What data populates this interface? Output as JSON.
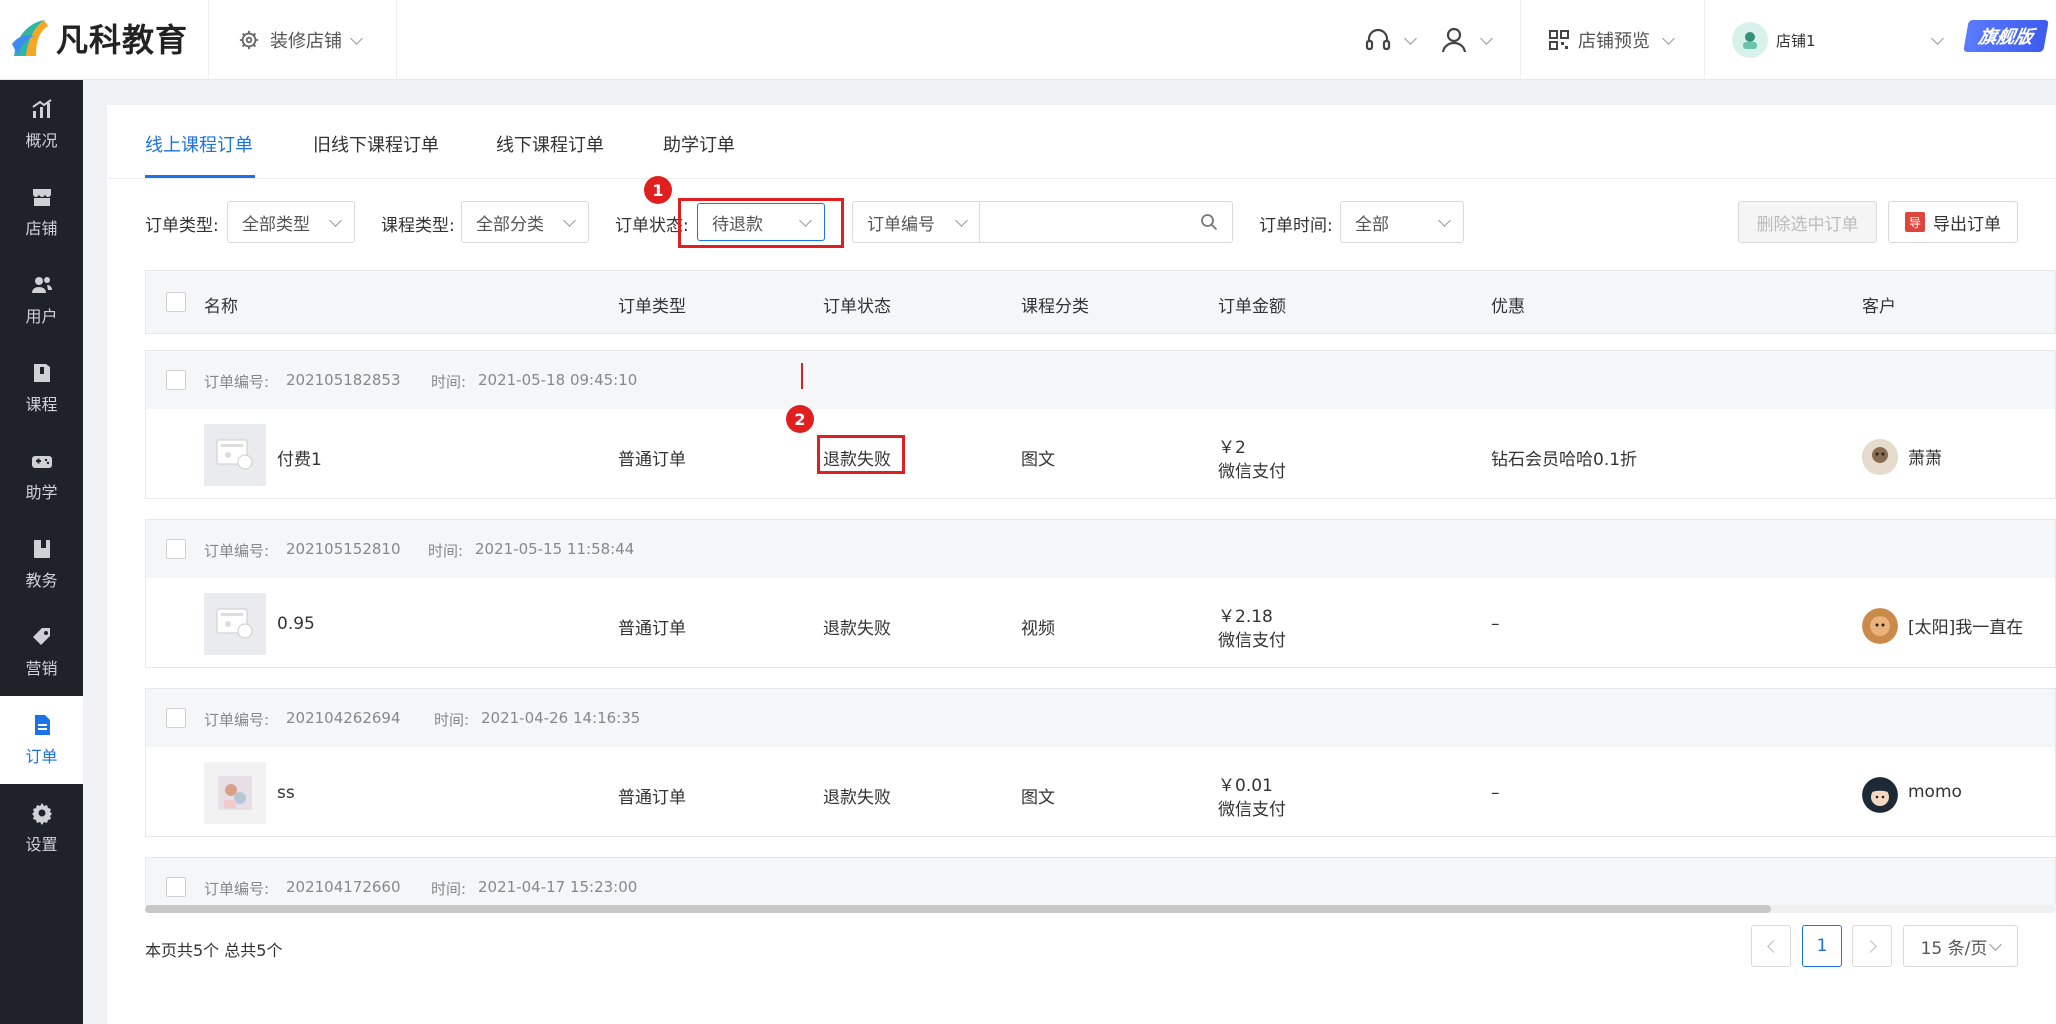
{
  "app": {
    "logo_text": "凡科教育"
  },
  "header": {
    "decorate_label": "装修店铺",
    "preview_label": "店铺预览",
    "store_name": "店铺1",
    "vip_badge": "旗舰版"
  },
  "sidebar": {
    "items": [
      {
        "label": "概况",
        "icon": "chart-icon"
      },
      {
        "label": "店铺",
        "icon": "store-icon"
      },
      {
        "label": "用户",
        "icon": "users-icon"
      },
      {
        "label": "课程",
        "icon": "book-icon"
      },
      {
        "label": "助学",
        "icon": "gamepad-icon"
      },
      {
        "label": "教务",
        "icon": "notebook-icon"
      },
      {
        "label": "营销",
        "icon": "tag-icon"
      },
      {
        "label": "订单",
        "icon": "document-icon"
      },
      {
        "label": "设置",
        "icon": "gear-icon"
      }
    ],
    "active": "订单"
  },
  "tabs": [
    {
      "label": "线上课程订单",
      "active": true
    },
    {
      "label": "旧线下课程订单",
      "active": false
    },
    {
      "label": "线下课程订单",
      "active": false
    },
    {
      "label": "助学订单",
      "active": false
    }
  ],
  "filters": {
    "order_type_label": "订单类型:",
    "order_type_value": "全部类型",
    "course_type_label": "课程类型:",
    "course_type_value": "全部分类",
    "status_label": "订单状态:",
    "status_value": "待退款",
    "search_field_select": "订单编号",
    "search_value": "",
    "time_label": "订单时间:",
    "time_value": "全部",
    "delete_button": "删除选中订单",
    "export_button": "导出订单",
    "export_icon_char": "导"
  },
  "annotations": {
    "step1": "1",
    "step2": "2"
  },
  "table": {
    "headers": [
      "名称",
      "订单类型",
      "订单状态",
      "课程分类",
      "订单金额",
      "优惠",
      "客户"
    ],
    "orders": [
      {
        "no_label": "订单编号:",
        "no": "202105182853",
        "time_label": "时间:",
        "time": "2021-05-18 09:45:10",
        "name": "付费1",
        "type": "普通订单",
        "status": "退款失败",
        "category": "图文",
        "amount": "￥2",
        "pay": "微信支付",
        "discount": "钻石会员哈哈0.1折",
        "customer": "萧萧"
      },
      {
        "no_label": "订单编号:",
        "no": "202105152810",
        "time_label": "时间:",
        "time": "2021-05-15 11:58:44",
        "name": "0.95",
        "type": "普通订单",
        "status": "退款失败",
        "category": "视频",
        "amount": "￥2.18",
        "pay": "微信支付",
        "discount": "–",
        "customer": "[太阳]我一直在"
      },
      {
        "no_label": "订单编号:",
        "no": "202104262694",
        "time_label": "时间:",
        "time": "2021-04-26 14:16:35",
        "name": "ss",
        "type": "普通订单",
        "status": "退款失败",
        "category": "图文",
        "amount": "￥0.01",
        "pay": "微信支付",
        "discount": "–",
        "customer": "momo"
      },
      {
        "no_label": "订单编号:",
        "no": "202104172660",
        "time_label": "时间:",
        "time": "2021-04-17 15:23:00"
      }
    ]
  },
  "footer": {
    "summary": "本页共5个 总共5个",
    "current_page": "1",
    "page_size": "15 条/页"
  }
}
